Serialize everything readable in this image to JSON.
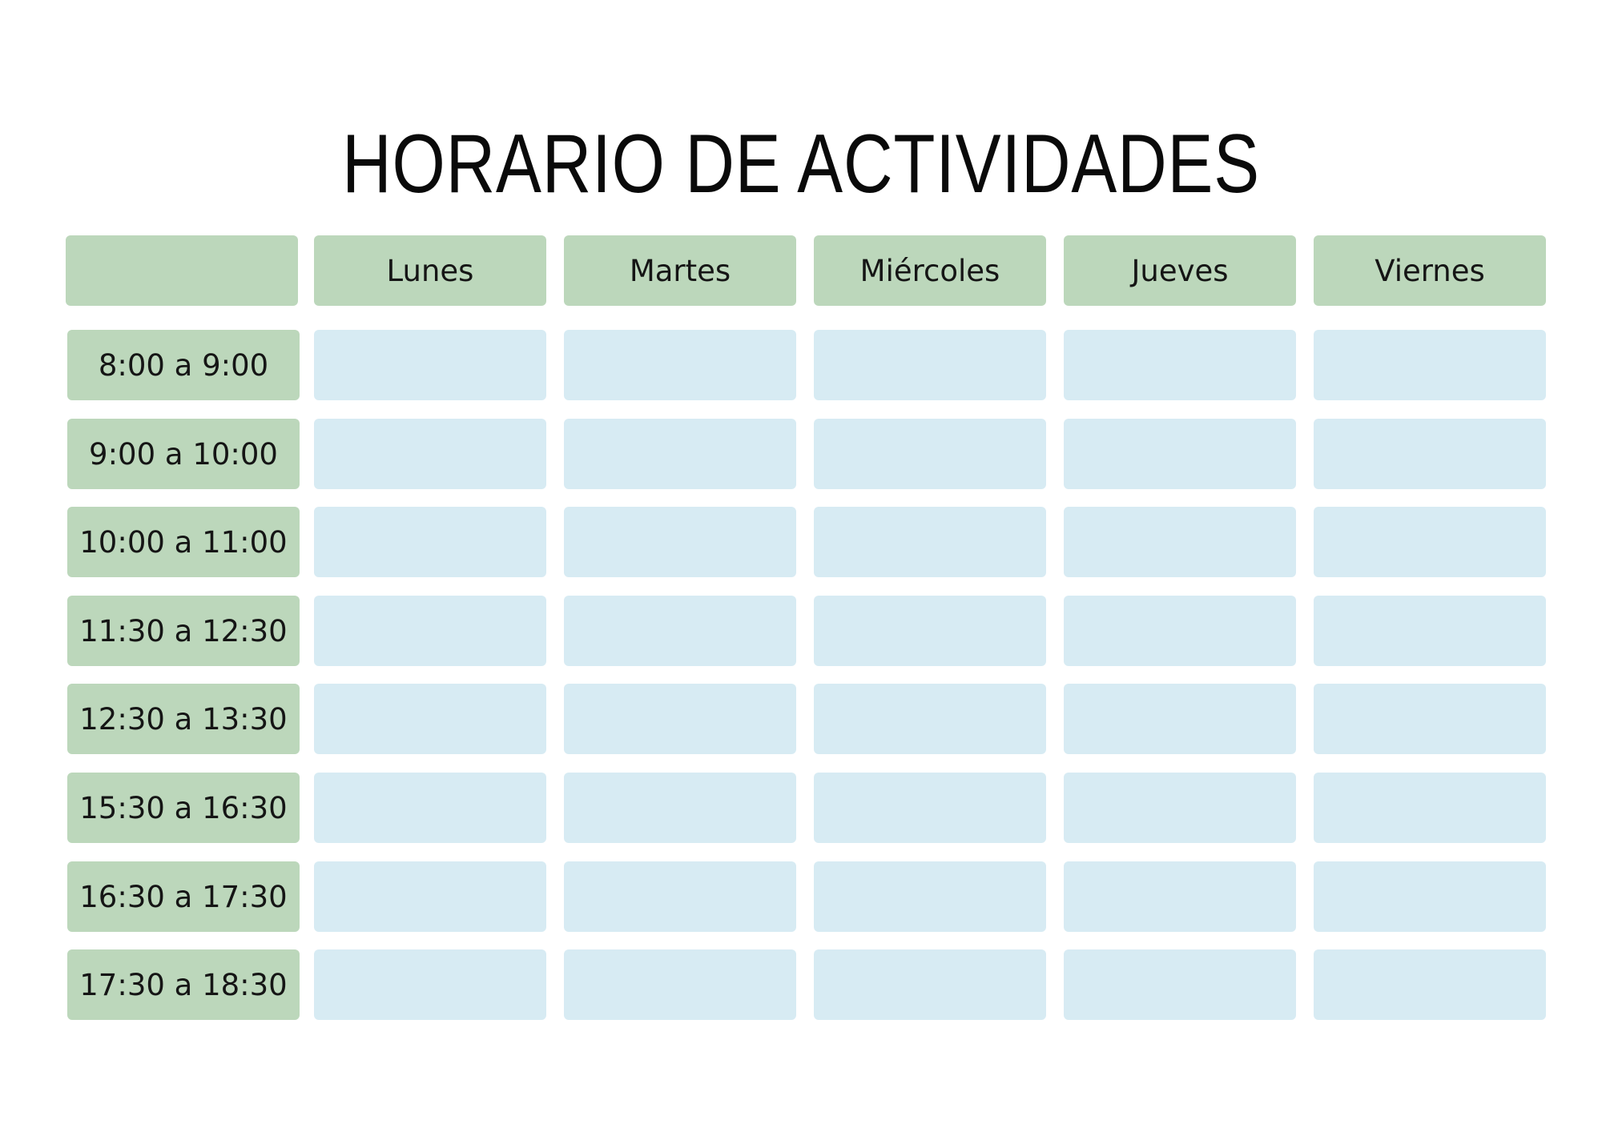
{
  "title": "HORARIO DE ACTIVIDADES",
  "colors": {
    "header_green": "#bcd7bb",
    "slot_blue": "#d7ebf3",
    "text": "#111111"
  },
  "days": [
    "",
    "Lunes",
    "Martes",
    "Miércoles",
    "Jueves",
    "Viernes"
  ],
  "times": [
    "8:00 a 9:00",
    "9:00 a 10:00",
    "10:00 a 11:00",
    "11:30 a 12:30",
    "12:30 a 13:30",
    "15:30 a 16:30",
    "16:30 a 17:30",
    "17:30 a 18:30"
  ]
}
